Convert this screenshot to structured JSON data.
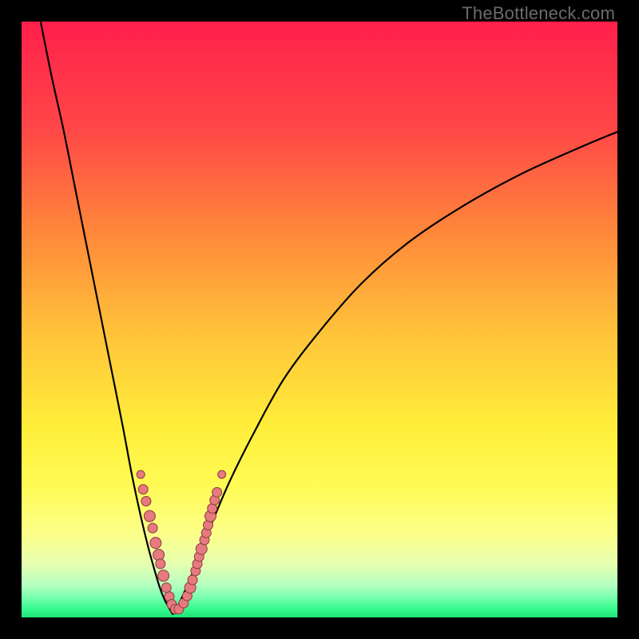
{
  "watermark": "TheBottleneck.com",
  "colors": {
    "frame": "#000000",
    "curve": "#000000",
    "markers_fill": "#e77a7f",
    "markers_stroke": "#8a3b3f",
    "gradient_stops": [
      {
        "offset": 0.0,
        "color": "#ff1f4b"
      },
      {
        "offset": 0.18,
        "color": "#ff4747"
      },
      {
        "offset": 0.36,
        "color": "#ff8a3a"
      },
      {
        "offset": 0.52,
        "color": "#ffc23a"
      },
      {
        "offset": 0.68,
        "color": "#ffee3a"
      },
      {
        "offset": 0.78,
        "color": "#fffb55"
      },
      {
        "offset": 0.86,
        "color": "#fcff8a"
      },
      {
        "offset": 0.91,
        "color": "#e6ffb0"
      },
      {
        "offset": 0.945,
        "color": "#b6ffc0"
      },
      {
        "offset": 0.965,
        "color": "#7dffb0"
      },
      {
        "offset": 0.985,
        "color": "#38f98e"
      },
      {
        "offset": 1.0,
        "color": "#1ee27a"
      }
    ]
  },
  "chart_data": {
    "type": "line",
    "title": "",
    "xlabel": "",
    "ylabel": "",
    "xlim": [
      0,
      100
    ],
    "ylim": [
      0,
      100
    ],
    "series": [
      {
        "name": "left-branch",
        "x": [
          3.2,
          5,
          7,
          9,
          11,
          13,
          15,
          17,
          18.5,
          20,
          21.2,
          22.3,
          23.2,
          24.0,
          24.8,
          25.4
        ],
        "y": [
          100,
          91,
          82,
          72,
          62,
          52,
          42,
          32,
          24,
          17,
          12,
          8,
          5,
          3,
          1.5,
          0.5
        ]
      },
      {
        "name": "right-branch",
        "x": [
          25.4,
          26.2,
          27.2,
          28.5,
          30,
          32,
          35,
          39,
          44,
          50,
          57,
          65,
          74,
          84,
          94,
          100
        ],
        "y": [
          0.5,
          1.8,
          4,
          7,
          11,
          16,
          23,
          31,
          40,
          48,
          56,
          63,
          69,
          74.5,
          79,
          81.5
        ]
      }
    ],
    "markers": {
      "name": "data-points",
      "points": [
        {
          "x": 20.0,
          "y": 24.0,
          "r": 5
        },
        {
          "x": 20.4,
          "y": 21.5,
          "r": 6
        },
        {
          "x": 20.9,
          "y": 19.5,
          "r": 6
        },
        {
          "x": 21.5,
          "y": 17.0,
          "r": 7
        },
        {
          "x": 22.0,
          "y": 15.0,
          "r": 6
        },
        {
          "x": 22.5,
          "y": 12.5,
          "r": 7
        },
        {
          "x": 23.0,
          "y": 10.5,
          "r": 7
        },
        {
          "x": 23.3,
          "y": 9.0,
          "r": 6
        },
        {
          "x": 23.8,
          "y": 7.0,
          "r": 7
        },
        {
          "x": 24.3,
          "y": 5.0,
          "r": 6
        },
        {
          "x": 24.8,
          "y": 3.5,
          "r": 6
        },
        {
          "x": 25.2,
          "y": 2.2,
          "r": 6
        },
        {
          "x": 25.8,
          "y": 1.4,
          "r": 6
        },
        {
          "x": 26.4,
          "y": 1.4,
          "r": 6
        },
        {
          "x": 27.2,
          "y": 2.4,
          "r": 6
        },
        {
          "x": 27.8,
          "y": 3.6,
          "r": 6
        },
        {
          "x": 28.3,
          "y": 5.0,
          "r": 7
        },
        {
          "x": 28.7,
          "y": 6.3,
          "r": 6
        },
        {
          "x": 29.2,
          "y": 7.8,
          "r": 6
        },
        {
          "x": 29.5,
          "y": 9.0,
          "r": 6
        },
        {
          "x": 29.8,
          "y": 10.2,
          "r": 6
        },
        {
          "x": 30.2,
          "y": 11.5,
          "r": 7
        },
        {
          "x": 30.7,
          "y": 13.0,
          "r": 6
        },
        {
          "x": 31.0,
          "y": 14.2,
          "r": 6
        },
        {
          "x": 31.3,
          "y": 15.5,
          "r": 6
        },
        {
          "x": 31.7,
          "y": 17.0,
          "r": 7
        },
        {
          "x": 32.0,
          "y": 18.3,
          "r": 6
        },
        {
          "x": 32.4,
          "y": 19.7,
          "r": 6
        },
        {
          "x": 32.8,
          "y": 21.0,
          "r": 6
        },
        {
          "x": 33.6,
          "y": 24.0,
          "r": 5
        }
      ]
    }
  }
}
